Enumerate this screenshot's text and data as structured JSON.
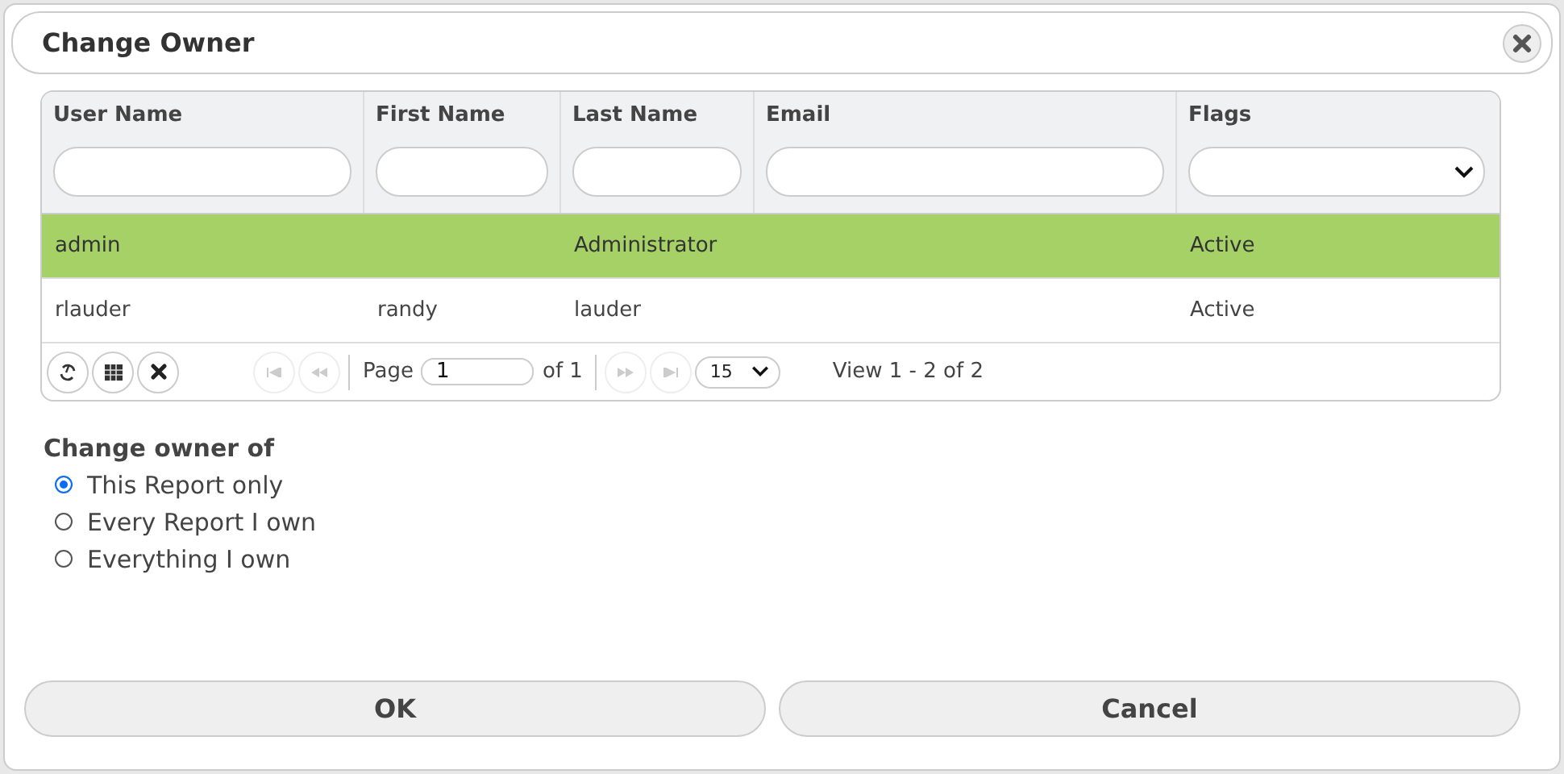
{
  "dialog": {
    "title": "Change Owner"
  },
  "table": {
    "columns": [
      {
        "label": "User Name",
        "kind": "text"
      },
      {
        "label": "First Name",
        "kind": "text"
      },
      {
        "label": "Last Name",
        "kind": "text"
      },
      {
        "label": "Email",
        "kind": "text"
      },
      {
        "label": "Flags",
        "kind": "select"
      }
    ],
    "rows": [
      {
        "cells": [
          "admin",
          "",
          "Administrator",
          "",
          "Active"
        ],
        "selected": true
      },
      {
        "cells": [
          "rlauder",
          "randy",
          "lauder",
          "",
          "Active"
        ],
        "selected": false
      }
    ]
  },
  "pager": {
    "page_label": "Page",
    "page": "1",
    "of": "of 1",
    "page_size": "15",
    "view": "View 1 - 2 of 2"
  },
  "options": {
    "label": "Change owner of",
    "items": [
      {
        "label": "This Report only",
        "selected": true
      },
      {
        "label": "Every Report I own",
        "selected": false
      },
      {
        "label": "Everything I own",
        "selected": false
      }
    ]
  },
  "buttons": [
    "OK",
    "Cancel"
  ]
}
